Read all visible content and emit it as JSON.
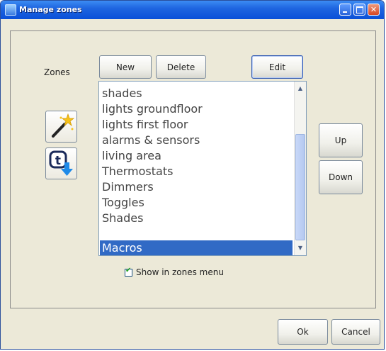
{
  "window": {
    "title": "Manage zones"
  },
  "zones_label": "Zones",
  "buttons": {
    "new": "New",
    "delete": "Delete",
    "edit": "Edit",
    "up": "Up",
    "down": "Down",
    "ok": "Ok",
    "cancel": "Cancel"
  },
  "zone_list": {
    "items": [
      "shades",
      "lights groundfloor",
      "lights first floor",
      "alarms & sensors",
      "living area",
      "Thermostats",
      "Dimmers",
      "Toggles",
      "Shades",
      "Macros"
    ],
    "selected": "Macros"
  },
  "show_in_menu": {
    "label": "Show in zones menu",
    "checked": true
  }
}
